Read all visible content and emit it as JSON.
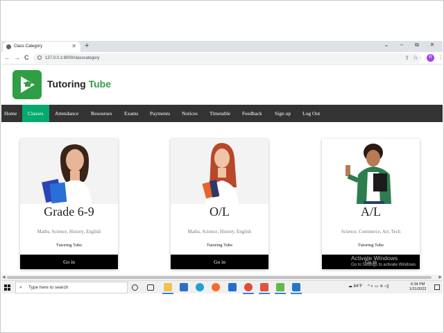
{
  "browser": {
    "tab_title": "Class Category",
    "tab_close": "✕",
    "new_tab": "+",
    "url": "127.0.0.1:8000/classcategory",
    "back": "←",
    "forward": "→",
    "reload": "C",
    "avatar_letter": "R",
    "window_controls": [
      "⌄",
      "–",
      "⧉",
      "✕"
    ]
  },
  "site": {
    "brand_part1": "Tutoring ",
    "brand_part2": "Tube",
    "brand_color": "#2f9e44",
    "nav": [
      {
        "label": "Home",
        "active": false
      },
      {
        "label": "Classes",
        "active": true
      },
      {
        "label": "Attendance",
        "active": false
      },
      {
        "label": "Resourses",
        "active": false
      },
      {
        "label": "Exams",
        "active": false
      },
      {
        "label": "Payments",
        "active": false
      },
      {
        "label": "Notices",
        "active": false
      },
      {
        "label": "Timetable",
        "active": false
      },
      {
        "label": "Feedback",
        "active": false
      },
      {
        "label": "Sign up",
        "active": false
      },
      {
        "label": "Log Out",
        "active": false
      }
    ],
    "nav_active_color": "#04aa6d",
    "nav_bg_color": "#333333"
  },
  "cards": [
    {
      "title": "Grade 6-9",
      "subjects": "Maths, Science, History, English",
      "brand": "Tutoring Tube",
      "button": "Go in"
    },
    {
      "title": "O/L",
      "subjects": "Maths, Science, History, English",
      "brand": "Tutoring Tube",
      "button": "Go in"
    },
    {
      "title": "A/L",
      "subjects": "Science, Commerce, Art, Tech",
      "brand": "Tutoring Tube",
      "button": "Go in"
    }
  ],
  "watermark": {
    "line1": "Activate Windows",
    "line2": "Go to Settings to activate Windows."
  },
  "taskbar": {
    "search_placeholder": "Type here to search",
    "weather": "84°F",
    "time": "6:34 PM",
    "date": "1/31/2022"
  }
}
